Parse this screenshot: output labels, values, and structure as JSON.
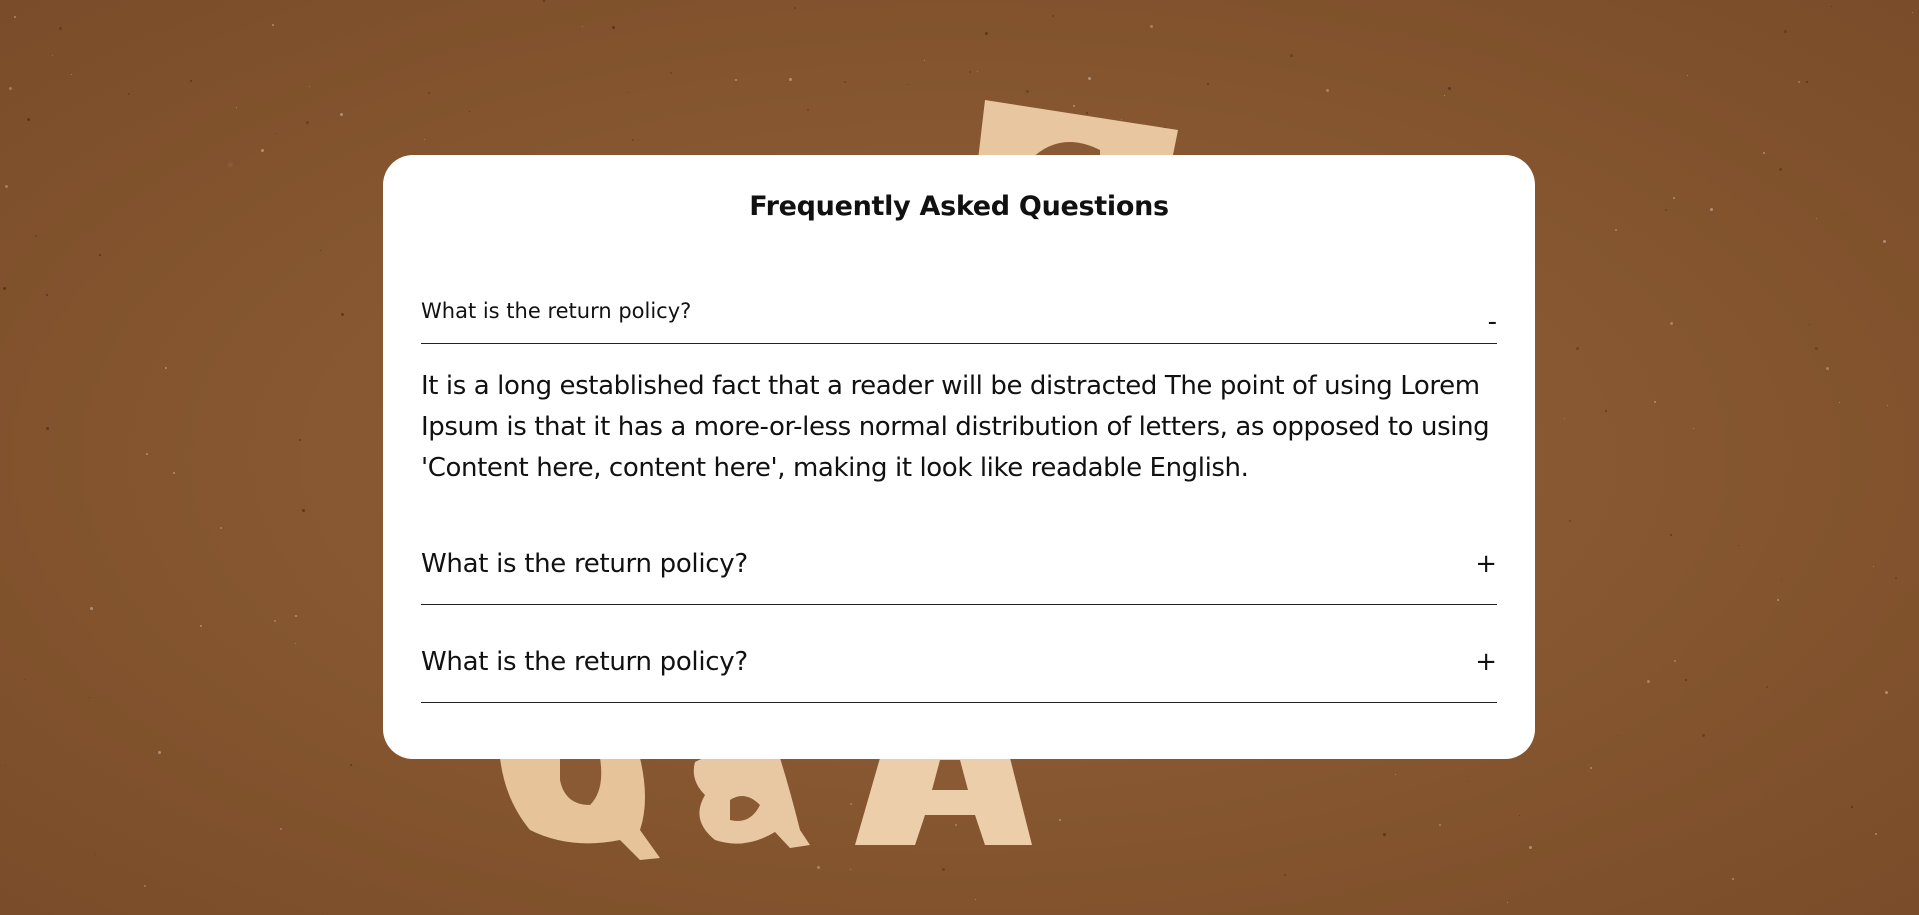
{
  "faq": {
    "title": "Frequently Asked Questions",
    "items": [
      {
        "question": "What is the return policy?",
        "toggle": "-",
        "expanded": true,
        "answer": "It is a long established fact that a reader will be distracted The point of using Lorem Ipsum is that it has a more-or-less normal distribution of letters, as opposed to using 'Content here, content here', making it look like readable English."
      },
      {
        "question": "What is the return policy?",
        "toggle": "+",
        "expanded": false
      },
      {
        "question": "What is the return policy?",
        "toggle": "+",
        "expanded": false
      }
    ]
  },
  "colors": {
    "background": "#8a5a34",
    "card": "#ffffff",
    "text": "#111111",
    "wood": "#e9c9a2"
  }
}
